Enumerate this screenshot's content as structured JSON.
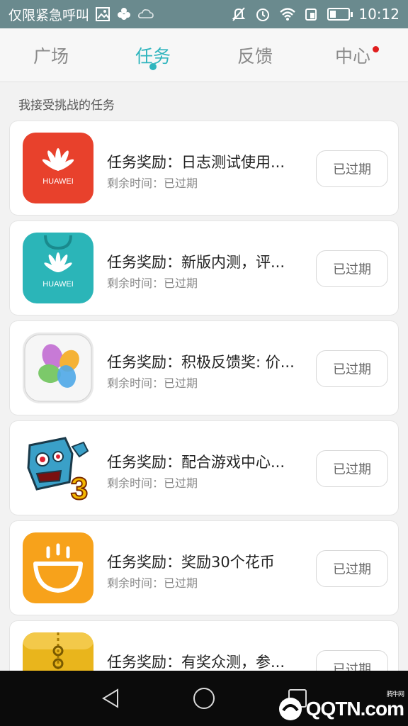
{
  "status_bar": {
    "notification_text": "仅限紧急呼叫",
    "time": "10:12",
    "battery_level": 0.35,
    "icons": [
      "image-icon",
      "flower-icon",
      "cloud-icon",
      "mute-icon",
      "alarm-icon",
      "wifi-icon",
      "sim-icon",
      "battery-icon"
    ]
  },
  "tabs": [
    {
      "label": "广场",
      "active": false
    },
    {
      "label": "任务",
      "active": true
    },
    {
      "label": "反馈",
      "active": false
    },
    {
      "label": "中心",
      "active": false,
      "badge": true
    }
  ],
  "section_title": "我接受挑战的任务",
  "tasks": [
    {
      "title": "任务奖励：日志测试使用...",
      "remaining": "剩余时间：已过期",
      "button": "已过期",
      "icon": "huawei-red-icon",
      "icon_text": "HUAWEI"
    },
    {
      "title": "任务奖励：新版内测，评...",
      "remaining": "剩余时间：已过期",
      "button": "已过期",
      "icon": "huawei-teal-bag-icon",
      "icon_text": "HUAWEI"
    },
    {
      "title": "任务奖励：积极反馈奖: 价...",
      "remaining": "剩余时间：已过期",
      "button": "已过期",
      "icon": "gallery-petals-icon"
    },
    {
      "title": "任务奖励：配合游戏中心...",
      "remaining": "剩余时间：已过期",
      "button": "已过期",
      "icon": "zombie-game-icon",
      "icon_text": "3"
    },
    {
      "title": "任务奖励：奖励30个花币",
      "remaining": "剩余时间：已过期",
      "button": "已过期",
      "icon": "smile-basket-icon"
    },
    {
      "title": "任务奖励：有奖众测，参...",
      "remaining": "",
      "button": "已过期",
      "icon": "zipper-folder-icon"
    }
  ],
  "nav_bar": {
    "icons": [
      "back-triangle-icon",
      "home-circle-icon",
      "recents-square-icon"
    ]
  },
  "watermark": {
    "text": "QQTN.com",
    "small": "腾牛网"
  },
  "colors": {
    "accent": "#2fb5be",
    "status_bar": "#6a8a8e",
    "badge": "#e01e1e",
    "huawei_red": "#e8412c",
    "huawei_teal": "#2bb5b8",
    "orange": "#f7a21b"
  }
}
